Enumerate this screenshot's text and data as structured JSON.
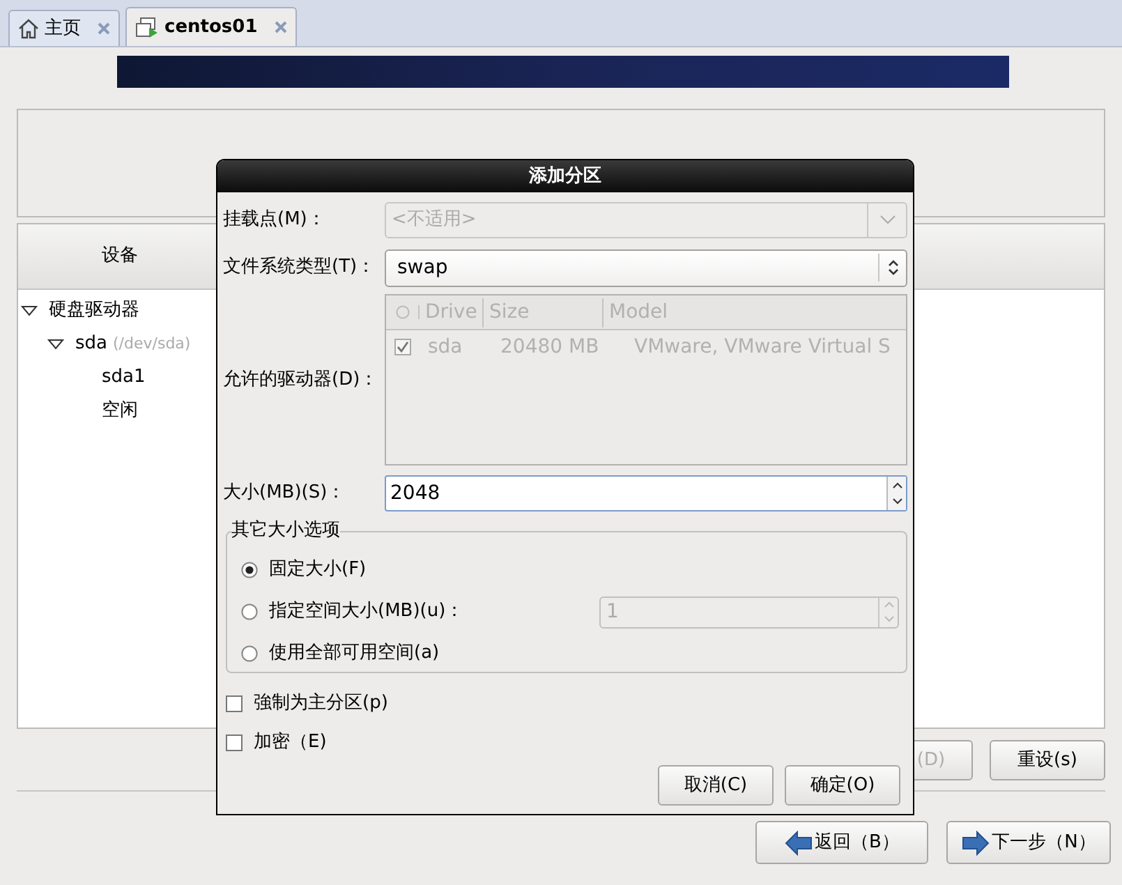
{
  "tabs": [
    {
      "label": "主页",
      "kind": "home",
      "selected": false
    },
    {
      "label": "centos01",
      "kind": "vm",
      "selected": true
    }
  ],
  "device_panel": {
    "column_1": "设备",
    "tree": [
      {
        "label": "硬盘驱动器",
        "expanded": true,
        "children": [
          {
            "label": "sda",
            "detail": "(/dev/sda)",
            "expanded": true,
            "children": [
              {
                "label": "sda1"
              },
              {
                "label": "空闲"
              }
            ]
          }
        ]
      }
    ]
  },
  "panel_buttons": [
    {
      "label": "(D)",
      "disabled": true
    },
    {
      "label": "重设(s)",
      "disabled": false
    }
  ],
  "nav_buttons": [
    {
      "label": "返回（B）",
      "kind": "back"
    },
    {
      "label": "下一步（N）",
      "kind": "next"
    }
  ],
  "dialog": {
    "title": "添加分区",
    "mount_point": {
      "label": "挂载点(M)：",
      "value": "<不适用>",
      "disabled": true
    },
    "fs_type": {
      "label": "文件系统类型(T)：",
      "value": "swap"
    },
    "drives": {
      "label": "允许的驱动器(D)：",
      "columns": [
        "Drive",
        "Size",
        "Model"
      ],
      "disabled": true,
      "rows": [
        {
          "checked": true,
          "drive": "sda",
          "size": "20480 MB",
          "model": "VMware, VMware Virtual S"
        }
      ]
    },
    "size": {
      "label": "大小(MB)(S)：",
      "value": "2048"
    },
    "other_options": {
      "legend": "其它大小选项",
      "options": [
        {
          "label": "固定大小(F)",
          "selected": true
        },
        {
          "label": "指定空间大小(MB)(u)：",
          "selected": false,
          "value": "1"
        },
        {
          "label": "使用全部可用空间(a)",
          "selected": false
        }
      ]
    },
    "checkboxes": [
      {
        "label": "強制为主分区(p)",
        "checked": false
      },
      {
        "label": "加密（E)",
        "checked": false
      }
    ],
    "buttons": [
      "取消(C)",
      "确定(O)"
    ]
  }
}
